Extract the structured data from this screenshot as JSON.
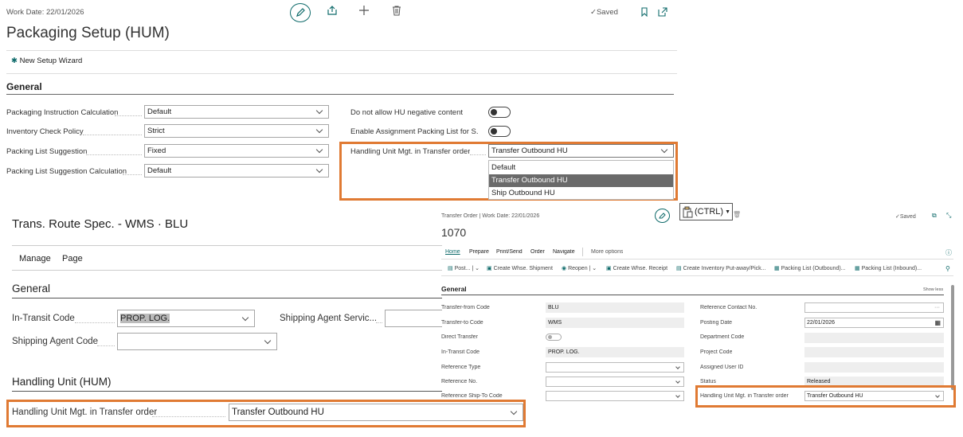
{
  "top": {
    "work_date": "Work Date: 22/01/2026",
    "title": "Packaging Setup (HUM)",
    "saved": "Saved",
    "wizard": "New Setup Wizard",
    "section": "General",
    "fields_left": [
      {
        "label": "Packaging Instruction Calculation",
        "value": "Default"
      },
      {
        "label": "Inventory Check Policy",
        "value": "Strict"
      },
      {
        "label": "Packing List Suggestion",
        "value": "Fixed"
      },
      {
        "label": "Packing List Suggestion Calculation",
        "value": "Default"
      }
    ],
    "fields_right": [
      {
        "label": "Do not allow HU negative content"
      },
      {
        "label": "Enable Assignment Packing List for S..."
      }
    ],
    "hu_field": {
      "label": "Handling Unit Mgt. in Transfer order",
      "value": "Transfer Outbound HU"
    },
    "options": [
      "Default",
      "Transfer Outbound HU",
      "Ship Outbound HU"
    ]
  },
  "left": {
    "title": "Trans. Route Spec. - WMS · BLU",
    "tabs": [
      "Manage",
      "Page"
    ],
    "general": "General",
    "in_transit": {
      "label": "In-Transit Code",
      "value": "PROP. LOG."
    },
    "agent": {
      "label": "Shipping Agent Code",
      "value": ""
    },
    "agent_service": {
      "label": "Shipping Agent Servic...",
      "value": ""
    },
    "hum_section": "Handling Unit (HUM)",
    "hu_field": {
      "label": "Handling Unit Mgt. in Transfer order",
      "value": "Transfer Outbound HU"
    }
  },
  "paste": {
    "label": "(CTRL)"
  },
  "right": {
    "header": "Transfer Order | Work Date: 22/01/2026",
    "number": "1070",
    "saved": "Saved",
    "menu": [
      "Home",
      "Prepare",
      "Print/Send",
      "Order",
      "Navigate",
      "More options"
    ],
    "actions": [
      "Post...",
      "Create Whse. Shipment",
      "Reopen",
      "Create Whse. Receipt",
      "Create Inventory Put-away/Pick...",
      "Packing List (Outbound)...",
      "Packing List (Inbound)..."
    ],
    "section": "General",
    "show_less": "Show less",
    "left_fields": [
      {
        "label": "Transfer-from Code",
        "value": "BLU"
      },
      {
        "label": "Transfer-to Code",
        "value": "WMS"
      },
      {
        "label": "Direct Transfer",
        "value": ""
      },
      {
        "label": "In-Transit Code",
        "value": "PROP. LOG."
      },
      {
        "label": "Reference Type",
        "value": ""
      },
      {
        "label": "Reference No.",
        "value": ""
      },
      {
        "label": "Reference Ship-To Code",
        "value": ""
      }
    ],
    "right_fields": [
      {
        "label": "Reference Contact No.",
        "value": ""
      },
      {
        "label": "Posting Date",
        "value": "22/01/2026"
      },
      {
        "label": "Department Code",
        "value": ""
      },
      {
        "label": "Project Code",
        "value": ""
      },
      {
        "label": "Assigned User ID",
        "value": ""
      },
      {
        "label": "Status",
        "value": "Released"
      },
      {
        "label": "Handling Unit Mgt. in Transfer order",
        "value": "Transfer Outbound HU"
      }
    ]
  },
  "colors": {
    "accent": "#0f6b6b",
    "highlight": "#e07a33"
  }
}
